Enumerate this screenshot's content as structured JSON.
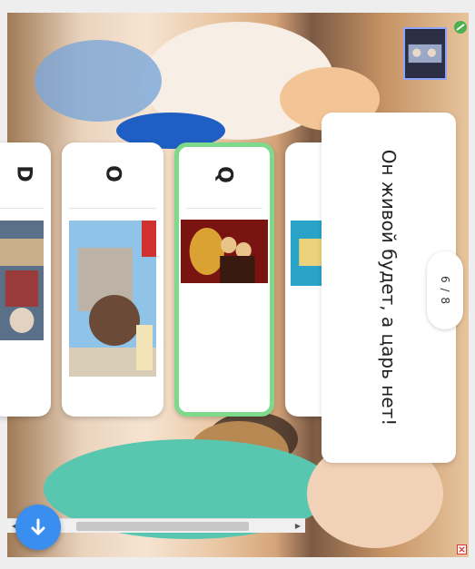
{
  "question": {
    "text": "Он живой будет, а царь нет!",
    "progress": "6 / 8"
  },
  "answers": [
    {
      "letter": "D",
      "selected": false
    },
    {
      "letter": "O",
      "selected": false
    },
    {
      "letter": "Q",
      "selected": true
    }
  ],
  "fab": {
    "icon": "arrow-down-icon"
  },
  "colors": {
    "selected_border": "#7fd98a",
    "fab_blue": "#3a8ef0",
    "card_bg": "#ffffff"
  }
}
